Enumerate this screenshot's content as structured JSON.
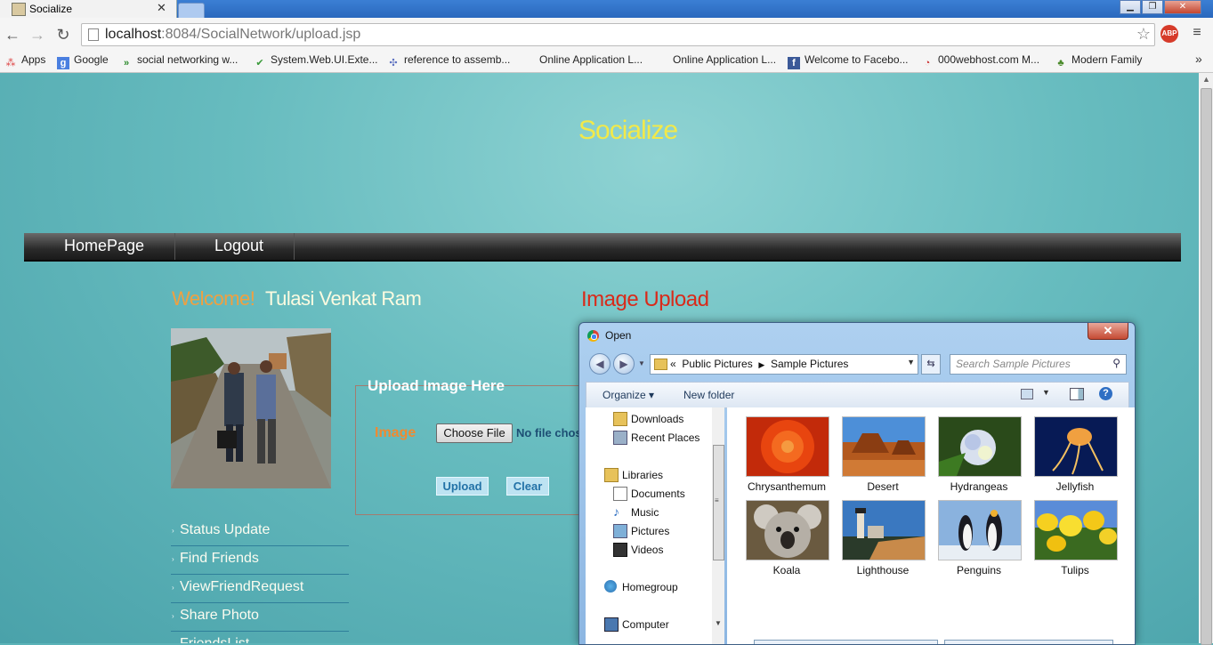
{
  "browser": {
    "tab_title": "Socialize",
    "tab_close": "✕",
    "url_host": "localhost",
    "url_rest": ":8084/SocialNetwork/upload.jsp",
    "abp_label": "ABP",
    "bookmarks": [
      {
        "label": "Apps",
        "icon": "apps-grid-icon"
      },
      {
        "label": "Google",
        "icon": "google-icon"
      },
      {
        "label": "social networking w...",
        "icon": "arrows-icon"
      },
      {
        "label": "System.Web.UI.Exte...",
        "icon": "check-icon"
      },
      {
        "label": "reference to assemb...",
        "icon": "puzzle-icon"
      },
      {
        "label": "Online Application L...",
        "icon": "blank-icon"
      },
      {
        "label": "Online Application L...",
        "icon": "blank-icon"
      },
      {
        "label": "Welcome to Facebo...",
        "icon": "facebook-icon"
      },
      {
        "label": "000webhost.com M...",
        "icon": "webhost-icon"
      },
      {
        "label": "Modern Family",
        "icon": "tree-icon"
      }
    ],
    "more_bookmarks": "»"
  },
  "site": {
    "title": "Socialize",
    "nav": [
      "HomePage",
      "Logout"
    ],
    "welcome_label": "Welcome!",
    "username": "Tulasi Venkat Ram",
    "upload_heading": "Image Upload",
    "side_menu": [
      "Status Update",
      "Find Friends",
      "ViewFriendRequest",
      "Share Photo",
      "FriendsList"
    ],
    "upload_form": {
      "legend": "Upload Image Here",
      "image_label": "Image",
      "choose_file": "Choose File",
      "no_file": "No file chosen",
      "upload_button": "Upload",
      "clear_button": "Clear"
    }
  },
  "dialog": {
    "title": "Open",
    "close": "✕",
    "path_prefix": "«",
    "path": [
      "Public Pictures",
      "Sample Pictures"
    ],
    "search_placeholder": "Search Sample Pictures",
    "organize": "Organize ▾",
    "new_folder": "New folder",
    "help": "?",
    "nav_items": [
      {
        "label": "Downloads",
        "icon": "downloads-folder-icon"
      },
      {
        "label": "Recent Places",
        "icon": "recent-places-icon"
      },
      {
        "label": "Libraries",
        "icon": "libraries-icon"
      },
      {
        "label": "Documents",
        "icon": "documents-icon"
      },
      {
        "label": "Music",
        "icon": "music-icon"
      },
      {
        "label": "Pictures",
        "icon": "pictures-icon"
      },
      {
        "label": "Videos",
        "icon": "videos-icon"
      },
      {
        "label": "Homegroup",
        "icon": "homegroup-icon"
      },
      {
        "label": "Computer",
        "icon": "computer-icon"
      }
    ],
    "files": [
      "Chrysanthemum",
      "Desert",
      "Hydrangeas",
      "Jellyfish",
      "Koala",
      "Lighthouse",
      "Penguins",
      "Tulips"
    ]
  }
}
